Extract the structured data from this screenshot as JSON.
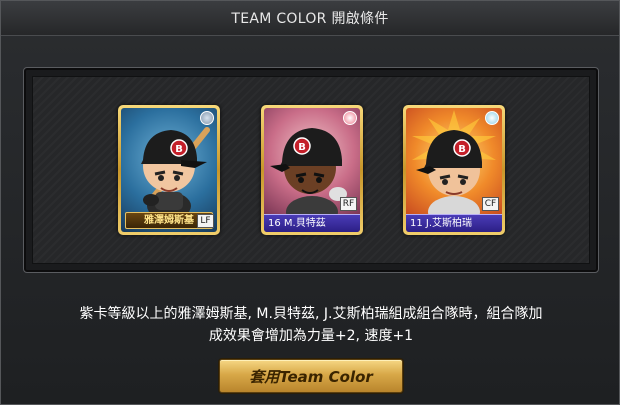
{
  "dialog": {
    "title": "TEAM COLOR 開啟條件"
  },
  "cards": [
    {
      "name": "雅澤姆斯基",
      "position": "LF",
      "tier": "gold",
      "gem_icon": "baseball-icon"
    },
    {
      "name": "16 M.貝特茲",
      "position": "RF",
      "tier": "purple",
      "gem_icon": "star-badge-icon"
    },
    {
      "name": "11 J.艾斯柏瑞",
      "position": "CF",
      "tier": "purple",
      "gem_icon": "snowflake-badge-icon"
    }
  ],
  "description": {
    "line1": "紫卡等級以上的雅澤姆斯基, M.貝特茲, J.艾斯柏瑞組成組合隊時，組合隊加",
    "line2": "成效果會增加為力量+2, 速度+1"
  },
  "apply_button": {
    "label": "套用Team Color"
  },
  "colors": {
    "accent_gold": "#d8a848",
    "name_plate_purple": "#3a2ca0",
    "helmet_black": "#1c1c1c",
    "team_red": "#c4202a"
  }
}
